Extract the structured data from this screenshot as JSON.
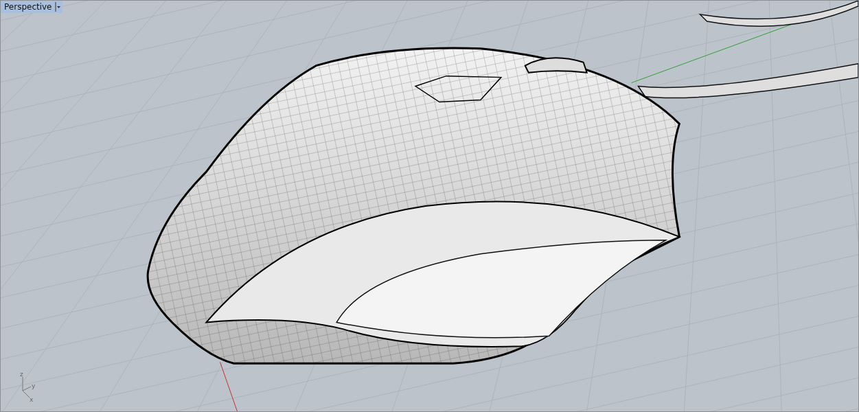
{
  "viewport": {
    "tab": {
      "label": "Perspective"
    }
  },
  "axis_widget": {
    "labels": [
      "z",
      "y",
      "x"
    ]
  }
}
